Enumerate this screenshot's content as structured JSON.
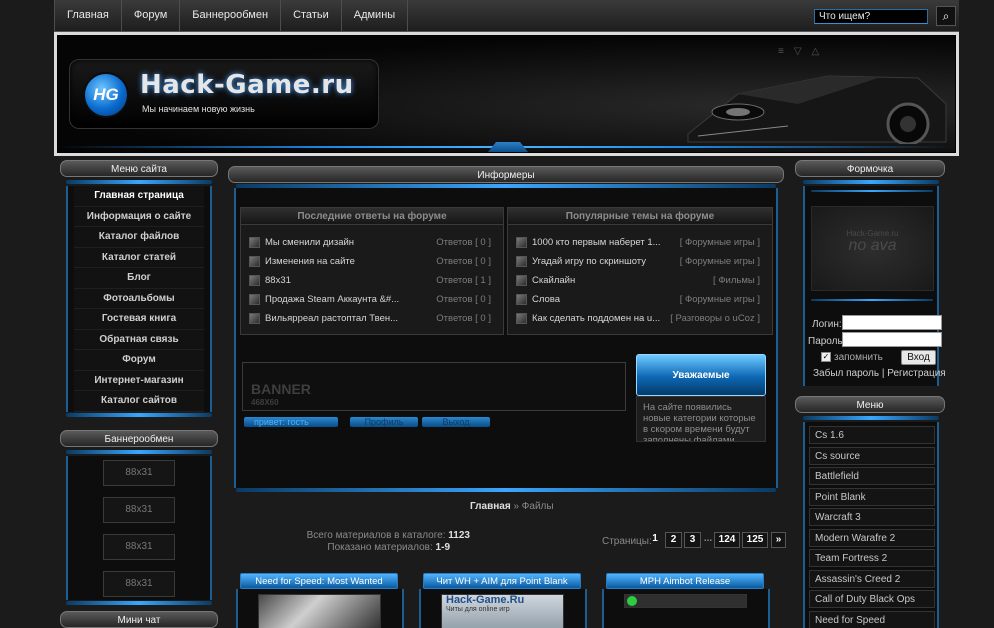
{
  "topnav": {
    "items": [
      "Главная",
      "Форум",
      "Баннерообмен",
      "Статьи",
      "Админы"
    ],
    "search_placeholder": "Что ищем?"
  },
  "header": {
    "logo_badge": "HG",
    "logo_title": "Hack-Game.ru",
    "logo_subtitle": "Мы начинаем новую жизнь"
  },
  "left": {
    "menu_title": "Меню сайта",
    "menu_items": [
      "Главная страница",
      "Информация о сайте",
      "Каталог файлов",
      "Каталог статей",
      "Блог",
      "Фотоальбомы",
      "Гостевая книга",
      "Обратная связь",
      "Форум",
      "Интернет-магазин",
      "Каталог сайтов"
    ],
    "banner_title": "Баннерообмен",
    "banners": [
      "88x31",
      "88x31",
      "88x31",
      "88x31"
    ],
    "chat_title": "Мини чат"
  },
  "center": {
    "informers_title": "Информеры",
    "forum_replies_title": "Последние ответы на форуме",
    "forum_replies": [
      {
        "title": "Мы сменили дизайн",
        "meta": "Ответов [ 0 ]"
      },
      {
        "title": "Изменения на сайте",
        "meta": "Ответов [ 0 ]"
      },
      {
        "title": "88x31",
        "meta": "Ответов [ 1 ]"
      },
      {
        "title": "Продажа Steam Аккаунта &#...",
        "meta": "Ответов [ 0 ]"
      },
      {
        "title": "Вильярреал растоптал Твен...",
        "meta": "Ответов [ 0 ]"
      }
    ],
    "popular_title": "Популярные темы на форуме",
    "popular": [
      {
        "title": "1000 кто первым наберет 1...",
        "meta": "[ Форумные игры ]"
      },
      {
        "title": "Угадай игру по скриншоту",
        "meta": "[ Форумные игры ]"
      },
      {
        "title": "Скайлайн",
        "meta": "[ Фильмы ]"
      },
      {
        "title": "Слова",
        "meta": "[ Форумные игры ]"
      },
      {
        "title": "Как сделать поддомен на u...",
        "meta": "[ Разговоры о uCoz ]"
      }
    ],
    "banner_label": "BANNER",
    "banner_size": "468X60",
    "greeting": "привет: гость",
    "btn1": "Профиль",
    "btn2": "Выход",
    "notice_title": "Уважаемые пользователи!",
    "notice_text": "На сайте появились новые категории которые в скором времени будут заполнены файлами",
    "breadcrumb_home": "Главная",
    "breadcrumb_sep": "»",
    "breadcrumb_current": "Файлы",
    "stats_total_label": "Всего материалов в каталоге:",
    "stats_total": "1123",
    "stats_shown_label": "Показано материалов:",
    "stats_shown": "1-9",
    "pages_label": "Страницы:",
    "pages": [
      "1",
      "2",
      "3",
      "...",
      "124",
      "125",
      "»"
    ],
    "items": [
      {
        "title": "Need for Speed: Most Wanted"
      },
      {
        "title": "Чит WH + AIM для Point Blank",
        "thumb_text": "Hack-Game.Ru",
        "thumb_sub": "Читы для online игр"
      },
      {
        "title": "MPH Aimbot Release"
      }
    ]
  },
  "right": {
    "form_title": "Формочка",
    "avatar_text": "no ava",
    "avatar_caption": "Hack-Game.ru",
    "login_label": "Логин:",
    "password_label": "Пароль:",
    "remember_label": "запомнить",
    "enter_button": "Вход",
    "forgot_link": "Забыл пароль",
    "sep": "|",
    "register_link": "Регистрация",
    "menu_title": "Меню",
    "menu_items": [
      "Cs 1.6",
      "Cs source",
      "Battlefield",
      "Point Blank",
      "Warcraft 3",
      "Modern Warafre 2",
      "Team Fortress 2",
      "Assassin's Creed 2",
      "Call of Duty Black Ops",
      "Need for Speed"
    ]
  },
  "colors": {
    "accent": "#3aa6ff",
    "background": "#1b1b1b"
  }
}
